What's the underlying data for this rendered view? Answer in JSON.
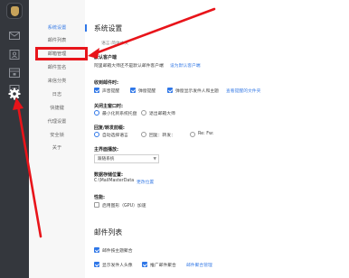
{
  "rail": {
    "icons": [
      "logo-icon",
      "mail-icon",
      "contacts-icon",
      "calendar-icon",
      "notes-icon",
      "settings-icon"
    ]
  },
  "nav": {
    "items": [
      {
        "label": "系统设置",
        "active": true
      },
      {
        "label": "邮件列表"
      },
      {
        "label": "邮箱管理"
      },
      {
        "label": "邮件签名"
      },
      {
        "label": "来信分类"
      },
      {
        "label": "日志"
      },
      {
        "label": "快捷键"
      },
      {
        "label": "代理设置"
      },
      {
        "label": "安全锁"
      },
      {
        "label": "关于"
      }
    ]
  },
  "main": {
    "title": "系统设置",
    "language_label": "语言:简体中文",
    "default_client": {
      "label": "默认客户端",
      "text": "阿里邮箱大师还不是默认邮件客户端",
      "link": "设为默认客户端"
    },
    "mail_received": {
      "label": "收到邮件时:",
      "options": [
        {
          "label": "声音提醒",
          "checked": true
        },
        {
          "label": "弹窗提醒",
          "checked": true
        },
        {
          "label": "弹窗显示发件人和主题",
          "checked": true
        }
      ],
      "link": "查看提醒的文件夹"
    },
    "close_main": {
      "label": "关闭主窗口时:",
      "options": [
        {
          "label": "最小化到系统托盘",
          "selected": true
        },
        {
          "label": "退出邮箱大师",
          "selected": false
        }
      ]
    },
    "reply_forward": {
      "label": "回复/转发前缀:",
      "options": [
        {
          "label": "自动选择语言",
          "selected": true
        },
        {
          "label": "回复：转发：",
          "selected": false
        },
        {
          "label": "Re: Fw:",
          "selected": false
        }
      ]
    },
    "theme": {
      "label": "主界面播放:",
      "value": "跟随系统"
    },
    "data_storage": {
      "label": "数据存储位置:",
      "path": "C:\\MailMasterData",
      "link": "更改位置"
    },
    "performance": {
      "label": "性能:",
      "option": {
        "label": "启用图形（GPU）加速",
        "checked": false
      }
    },
    "mail_list_title": "邮件列表",
    "mail_list": {
      "options": [
        {
          "label": "邮件按主题聚合",
          "checked": true
        },
        {
          "label": "显示发件人头像",
          "checked": true
        },
        {
          "label": "推广邮件聚合",
          "checked": true
        }
      ],
      "link": "邮件聚合管理"
    }
  },
  "colors": {
    "accent": "#2f77e8",
    "highlight": "#e8141a",
    "rail": "#34373d"
  }
}
